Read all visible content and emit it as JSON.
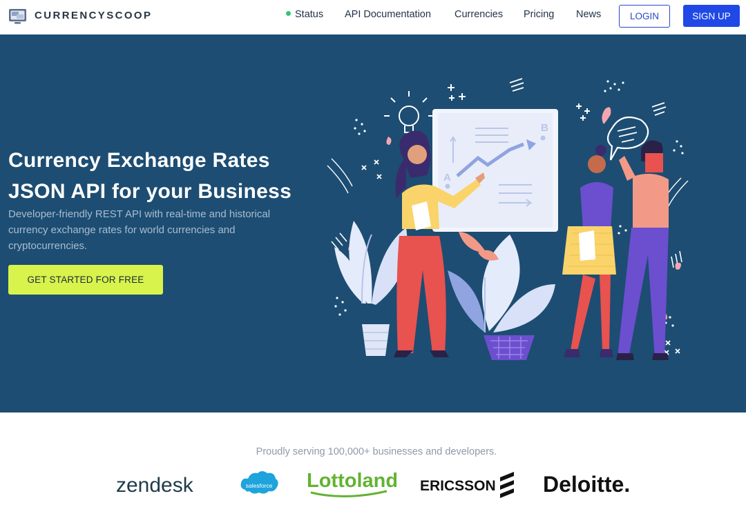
{
  "brand": {
    "name": "CURRENCYSCOOP",
    "logo_icon": "monitor-currency-icon"
  },
  "nav": {
    "status": "Status",
    "api_docs": "API Documentation",
    "currencies": "Currencies",
    "pricing": "Pricing",
    "news": "News",
    "login": "LOGIN",
    "signup": "SIGN UP"
  },
  "hero": {
    "title_line1": "Currency Exchange Rates",
    "title_line2": "JSON API for your Business",
    "subtitle": "Developer-friendly REST API with real-time and historical currency exchange rates for world currencies and cryptocurrencies.",
    "cta": "GET STARTED FOR FREE",
    "board_label_a": "A",
    "board_label_b": "B"
  },
  "clients": {
    "caption": "Proudly serving 100,000+ businesses and developers.",
    "logos": [
      "zendesk",
      "salesforce",
      "Lottoland",
      "ERICSSON",
      "Deloitte."
    ]
  },
  "colors": {
    "hero_bg": "#1d4d72",
    "cta_bg": "#d7f34c",
    "primary": "#1f48e6",
    "status_green": "#35c47a"
  }
}
